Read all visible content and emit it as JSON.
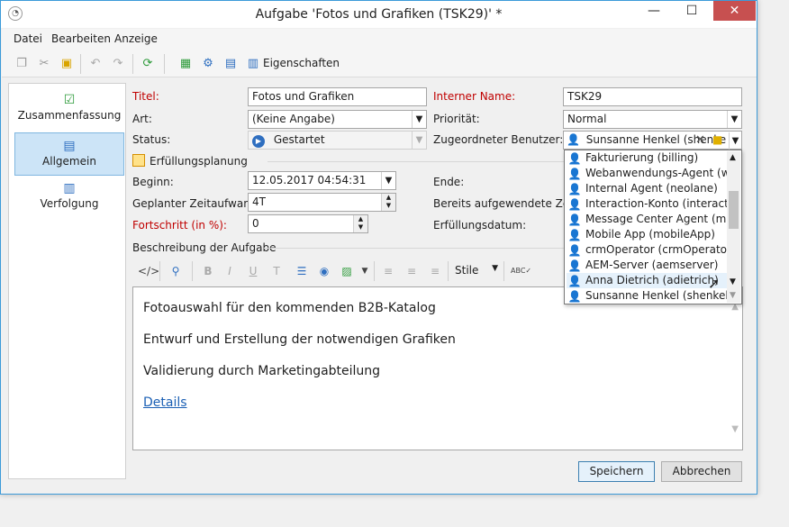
{
  "window": {
    "title": "Aufgabe 'Fotos und Grafiken (TSK29)' *",
    "close_label": "✕",
    "minimize_label": "—",
    "maximize_label": "☐"
  },
  "menu": [
    "Datei",
    "Bearbeiten",
    "Anzeige"
  ],
  "toolbar": {
    "properties_label": "Eigenschaften"
  },
  "sidebar": {
    "items": [
      {
        "label": "Zusammenfassung"
      },
      {
        "label": "Allgemein"
      },
      {
        "label": "Verfolgung"
      }
    ]
  },
  "form": {
    "title_label": "Titel:",
    "title_value": "Fotos und Grafiken",
    "internal_name_label": "Interner Name:",
    "internal_name_value": "TSK29",
    "type_label": "Art:",
    "type_value": "(Keine Angabe)",
    "priority_label": "Priorität:",
    "priority_value": "Normal",
    "status_label": "Status:",
    "status_value": "Gestartet",
    "assigned_user_label": "Zugeordneter Benutzer:",
    "assigned_user_value": "Sunsanne Henkel (shenke",
    "planning_group": "Erfüllungsplanung",
    "start_label": "Beginn:",
    "start_value": "12.05.2017 04:54:31",
    "end_label": "Ende:",
    "planned_effort_label": "Geplanter Zeitaufwand:",
    "planned_effort_value": "4T",
    "spent_time_label": "Bereits aufgewendete Zeit:",
    "progress_label": "Fortschritt (in %):",
    "progress_value": "0",
    "completion_date_label": "Erfüllungsdatum:",
    "description_group": "Beschreibung der Aufgabe"
  },
  "rte": {
    "style_label": "Stile"
  },
  "editor": {
    "lines": [
      "Fotoauswahl für den kommenden B2B-Katalog",
      "Entwurf und Erstellung der notwendigen Grafiken",
      "Validierung durch Marketingabteilung"
    ],
    "link": "Details"
  },
  "dropdown": {
    "items": [
      "Fakturierung (billing)",
      "Webanwendungs-Agent (we...",
      "Internal Agent (neolane)",
      "Interaction-Konto (interact...",
      "Message Center Agent (mc)",
      "Mobile App (mobileApp)",
      "crmOperator (crmOperator)",
      "AEM-Server (aemserver)",
      "Anna Dietrich (adietrich)",
      "Sunsanne Henkel (shenkel)"
    ]
  },
  "buttons": {
    "save": "Speichern",
    "cancel": "Abbrechen"
  }
}
